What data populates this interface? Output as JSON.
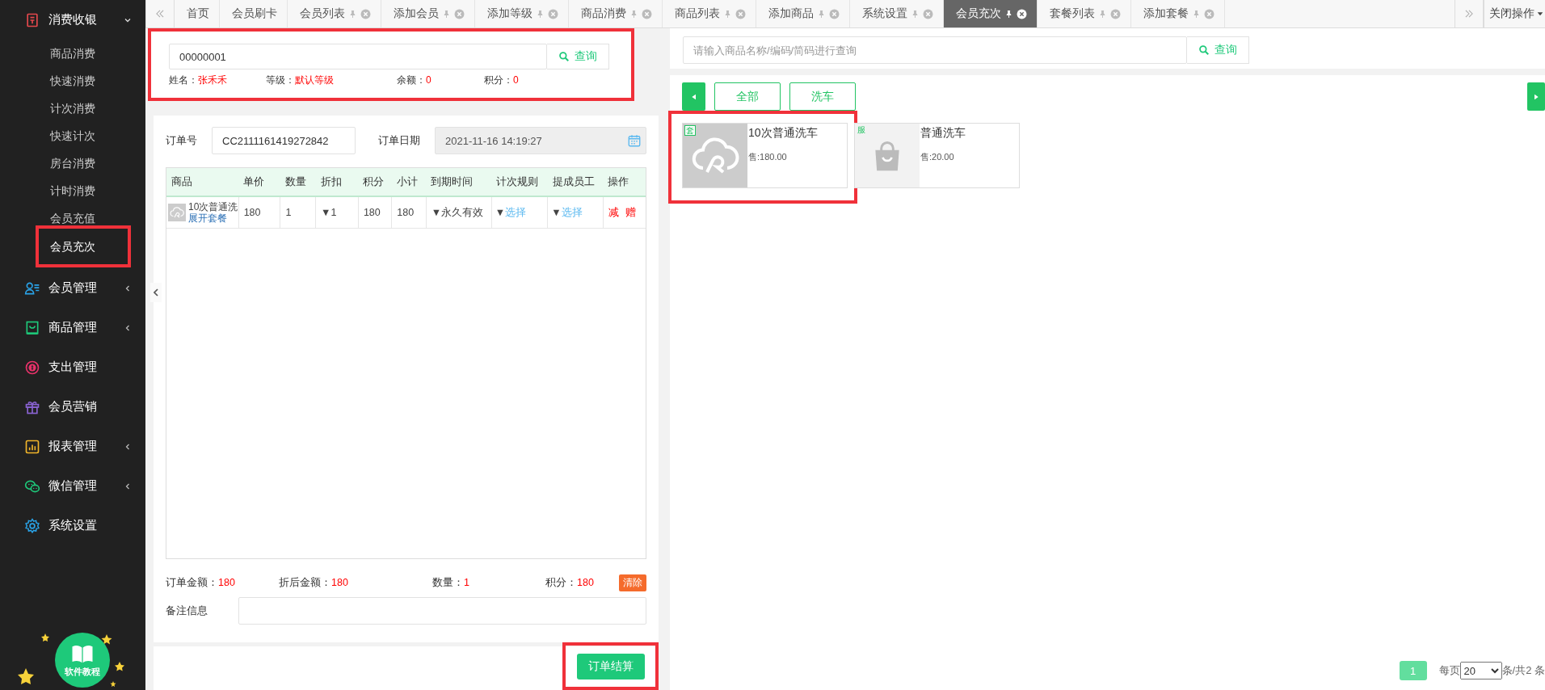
{
  "sidebar": {
    "groups": [
      {
        "label": "消费收银",
        "has_submenu": true,
        "expanded": true,
        "children": [
          {
            "label": "商品消费",
            "selected": false,
            "highlighted": false
          },
          {
            "label": "快速消费",
            "selected": false,
            "highlighted": false
          },
          {
            "label": "计次消费",
            "selected": false,
            "highlighted": false
          },
          {
            "label": "快速计次",
            "selected": false,
            "highlighted": false
          },
          {
            "label": "房台消费",
            "selected": false,
            "highlighted": false
          },
          {
            "label": "计时消费",
            "selected": false,
            "highlighted": false
          },
          {
            "label": "会员充值",
            "selected": false,
            "highlighted": false
          },
          {
            "label": "会员充次",
            "selected": true,
            "highlighted": true
          }
        ]
      },
      {
        "label": "会员管理",
        "has_submenu": true,
        "expanded": false
      },
      {
        "label": "商品管理",
        "has_submenu": true,
        "expanded": false
      },
      {
        "label": "支出管理",
        "has_submenu": false
      },
      {
        "label": "会员营销",
        "has_submenu": false
      },
      {
        "label": "报表管理",
        "has_submenu": true,
        "expanded": false
      },
      {
        "label": "微信管理",
        "has_submenu": true,
        "expanded": false
      },
      {
        "label": "系统设置",
        "has_submenu": false
      }
    ],
    "tutorial_badge": "软件教程"
  },
  "tabs": [
    {
      "label": "首页",
      "closable": false,
      "selected": false
    },
    {
      "label": "会员刷卡",
      "closable": false,
      "selected": false
    },
    {
      "label": "会员列表",
      "closable": true,
      "selected": false
    },
    {
      "label": "添加会员",
      "closable": true,
      "selected": false
    },
    {
      "label": "添加等级",
      "closable": true,
      "selected": false
    },
    {
      "label": "商品消费",
      "closable": true,
      "selected": false
    },
    {
      "label": "商品列表",
      "closable": true,
      "selected": false
    },
    {
      "label": "添加商品",
      "closable": true,
      "selected": false
    },
    {
      "label": "系统设置",
      "closable": true,
      "selected": false
    },
    {
      "label": "会员充次",
      "closable": true,
      "selected": true
    },
    {
      "label": "套餐列表",
      "closable": true,
      "selected": false
    },
    {
      "label": "添加套餐",
      "closable": true,
      "selected": false
    }
  ],
  "tab_menu": "关闭操作",
  "member": {
    "card_number": "00000001",
    "search_button": "查询",
    "highlighted": true,
    "fields": [
      {
        "label": "姓名：",
        "value": "张禾禾"
      },
      {
        "label": "等级：",
        "value": "默认等级"
      },
      {
        "label": "余额：",
        "value": "0"
      },
      {
        "label": "积分：",
        "value": "0"
      }
    ]
  },
  "order": {
    "number_label": "订单号",
    "number": "CC2111161419272842",
    "date_label": "订单日期",
    "date": "2021-11-16 14:19:27",
    "columns": [
      "商品",
      "单价",
      "数量",
      "折扣",
      "积分",
      "小计",
      "到期时间",
      "计次规则",
      "提成员工",
      "操作"
    ],
    "rows": [
      {
        "product": "10次普通洗",
        "expand_link": "展开套餐",
        "unit_price": "180",
        "quantity": "1",
        "discount": "▼1",
        "points": "180",
        "subtotal": "180",
        "expiry": "▼永久有效",
        "rule_arrow": "▼",
        "rule": "选择",
        "staff_arrow": "▼",
        "staff": "选择",
        "actions": [
          "减",
          "赠"
        ]
      }
    ],
    "totals": [
      {
        "label": "订单金额：",
        "value": "180"
      },
      {
        "label": "折后金额：",
        "value": "180"
      },
      {
        "label": "数量：",
        "value": "1"
      },
      {
        "label": "积分：",
        "value": "180"
      }
    ],
    "clear_button": "清除",
    "remark_label": "备注信息",
    "checkout_button": "订单结算",
    "checkout_highlighted": true
  },
  "products": {
    "search_placeholder": "请输入商品名称/编码/简码进行查询",
    "search_button": "查询",
    "categories": [
      "全部",
      "洗车"
    ],
    "items": [
      {
        "kind": "package",
        "tag": "套",
        "name": "10次普通洗车",
        "price": "售:180.00",
        "highlighted": true
      },
      {
        "kind": "service",
        "tag": "服",
        "name": "普通洗车",
        "price": "售:20.00",
        "highlighted": false
      }
    ],
    "pagination": {
      "pages": [
        {
          "label": "1",
          "selected": true
        }
      ],
      "per_page_label": "每页",
      "per_page": "20",
      "total": "条/共2 条"
    }
  }
}
